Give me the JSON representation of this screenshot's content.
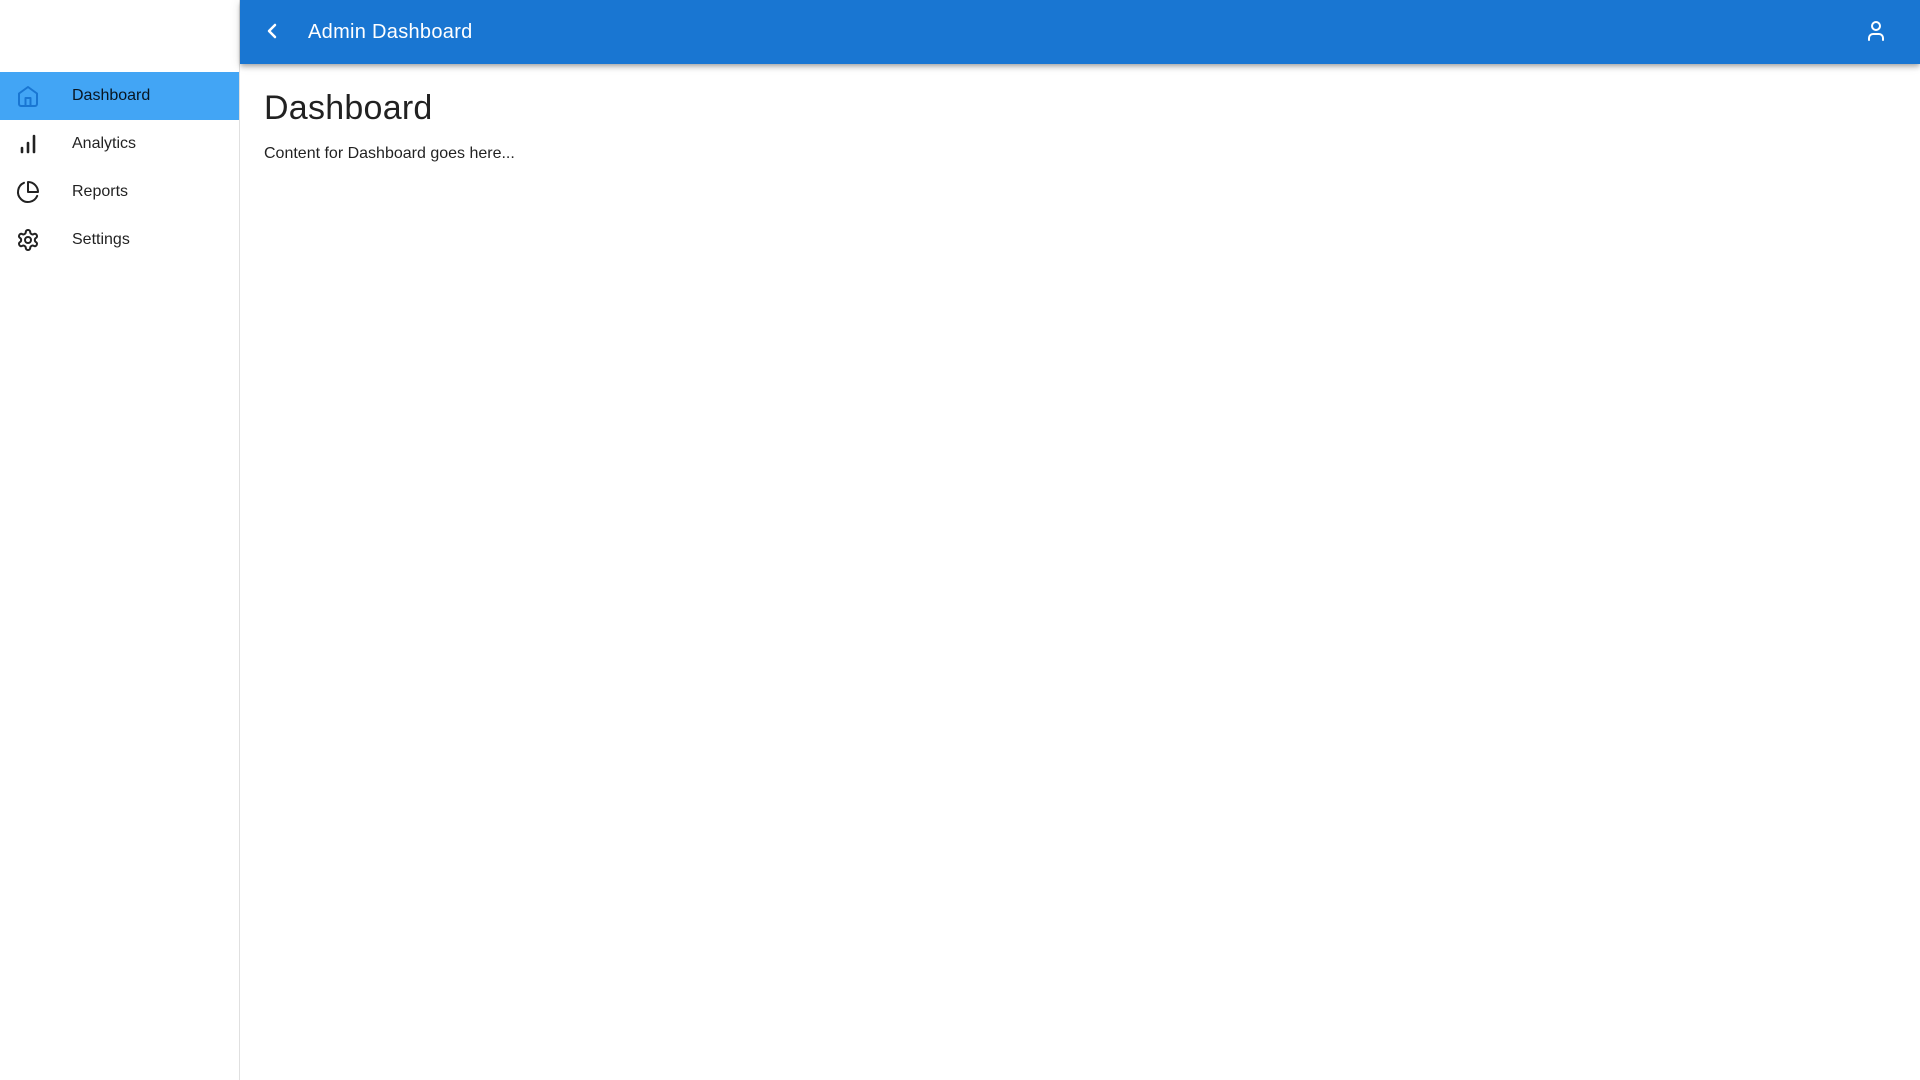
{
  "app_bar": {
    "title": "Admin Dashboard",
    "background_color": "#1976d2",
    "back_icon": "chevron-left-icon",
    "user_icon": "user-icon"
  },
  "sidebar": {
    "active_bg_color": "#42a5f5",
    "active_icon_color": "#1976d2",
    "items": [
      {
        "label": "Dashboard",
        "icon": "home-icon",
        "active": true
      },
      {
        "label": "Analytics",
        "icon": "bar-chart-icon",
        "active": false
      },
      {
        "label": "Reports",
        "icon": "pie-chart-icon",
        "active": false
      },
      {
        "label": "Settings",
        "icon": "gear-icon",
        "active": false
      }
    ]
  },
  "main": {
    "heading": "Dashboard",
    "body": "Content for Dashboard goes here..."
  }
}
